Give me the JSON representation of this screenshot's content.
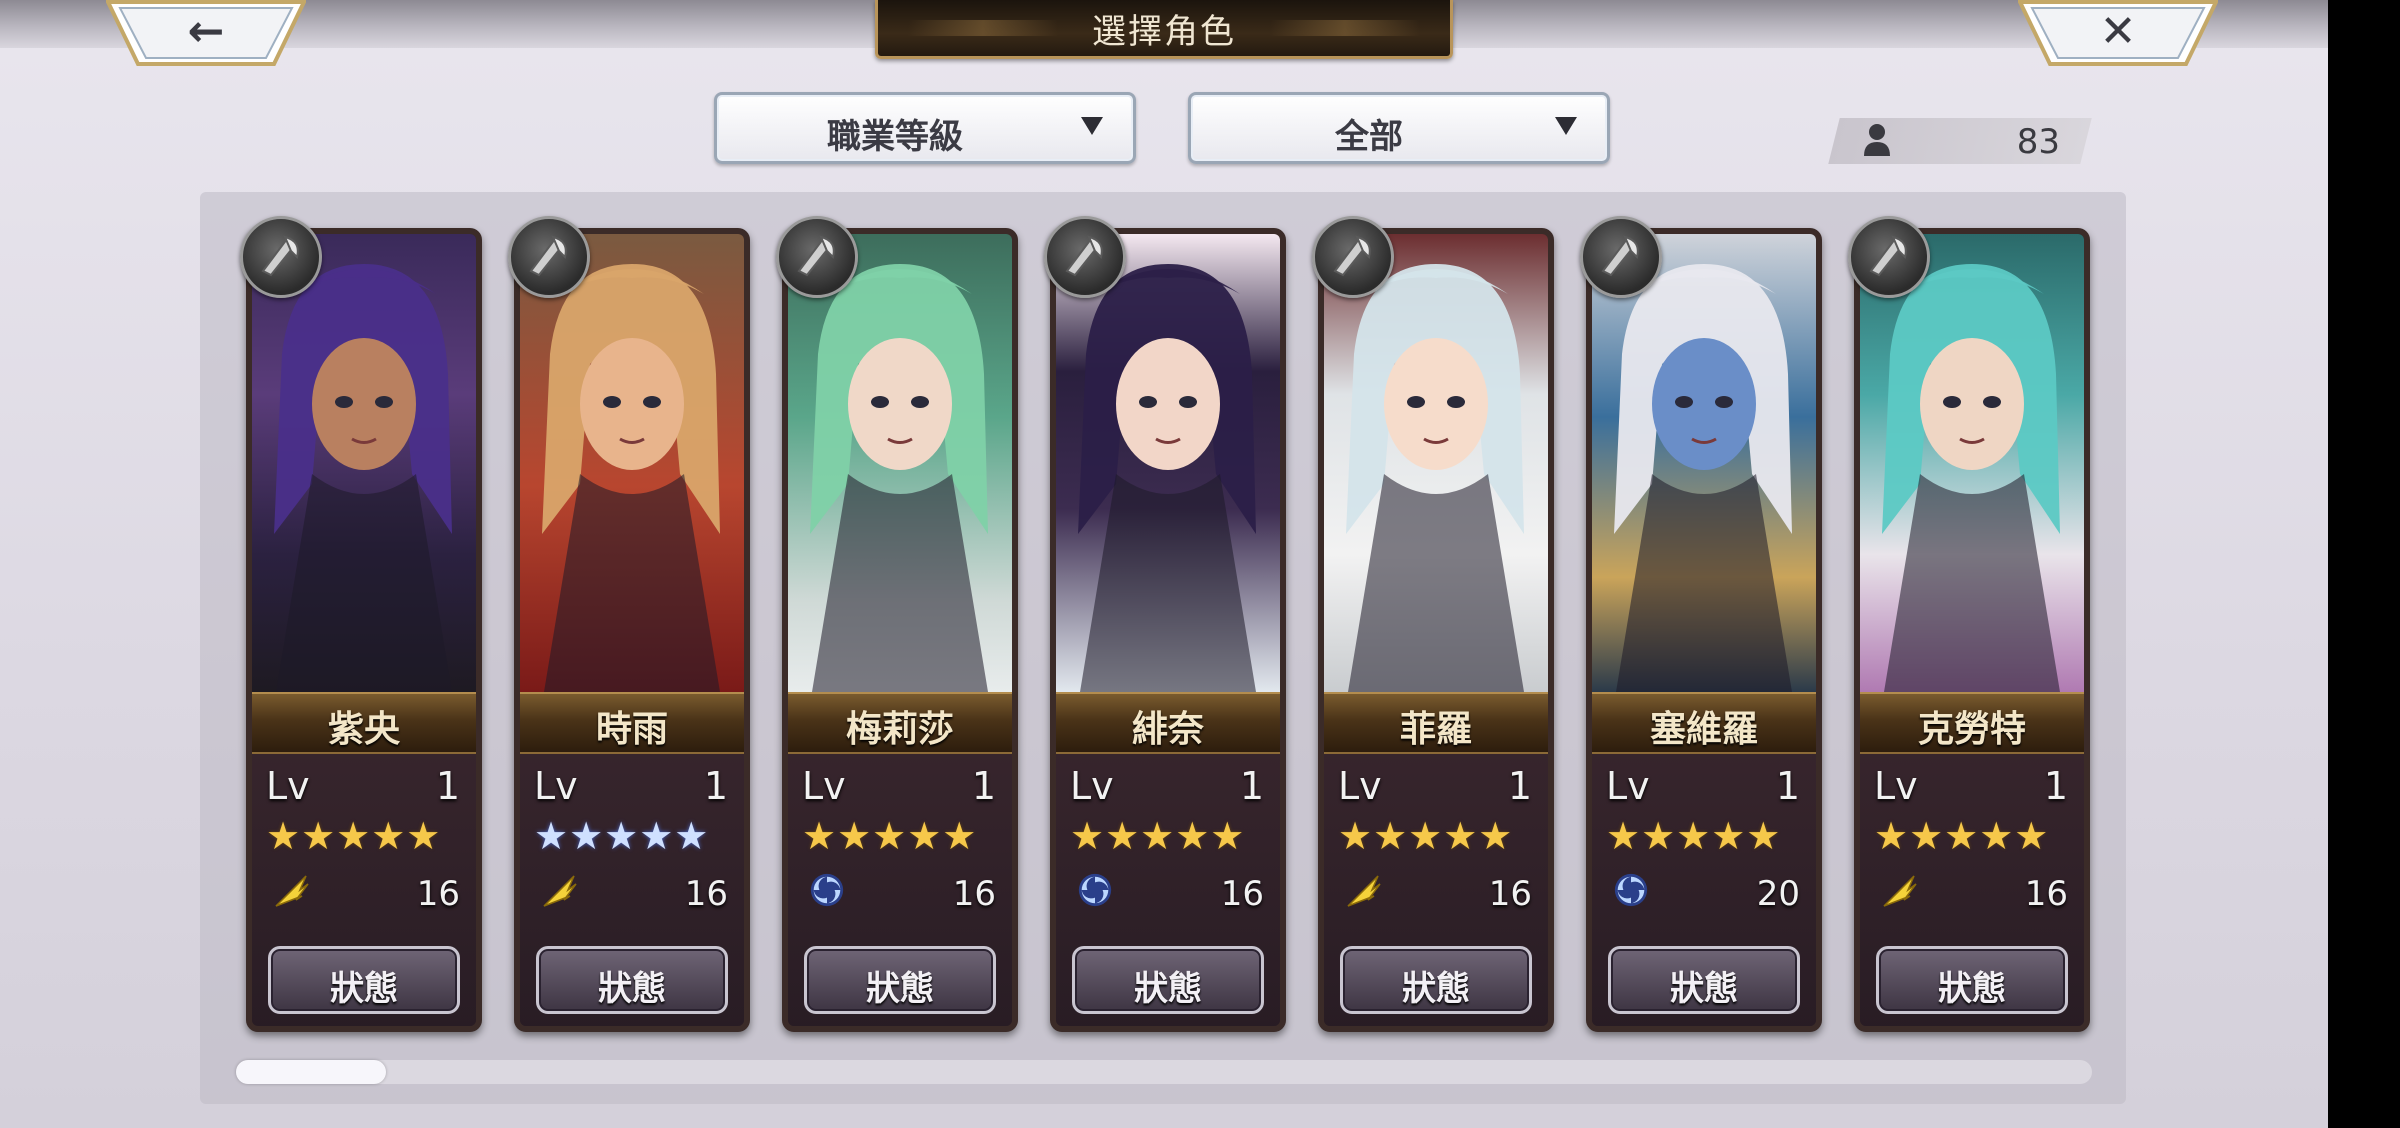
{
  "header": {
    "title": "選擇角色",
    "back_glyph": "←",
    "close_glyph": "✕"
  },
  "filters": {
    "class_label": "職業等級",
    "scope_label": "全部"
  },
  "roster_count": "83",
  "level_label": "Lv",
  "status_label": "狀態",
  "characters": [
    {
      "name": "紫央",
      "level": "1",
      "stars": "★★★★★",
      "element": "wing",
      "value": "16"
    },
    {
      "name": "時雨",
      "level": "1",
      "stars": "★★★★★",
      "element": "wing",
      "value": "16"
    },
    {
      "name": "梅莉莎",
      "level": "1",
      "stars": "★★★★★",
      "element": "swirl",
      "value": "16"
    },
    {
      "name": "緋奈",
      "level": "1",
      "stars": "★★★★★",
      "element": "swirl",
      "value": "16"
    },
    {
      "name": "菲羅",
      "level": "1",
      "stars": "★★★★★",
      "element": "wing",
      "value": "16"
    },
    {
      "name": "塞維羅",
      "level": "1",
      "stars": "★★★★★",
      "element": "swirl",
      "value": "20"
    },
    {
      "name": "克勞特",
      "level": "1",
      "stars": "★★★★★",
      "element": "wing",
      "value": "16"
    }
  ],
  "colors": {
    "gold_star": "#f6c84a",
    "silver_star": "#cfe0ff",
    "plate": "#2c2023"
  }
}
